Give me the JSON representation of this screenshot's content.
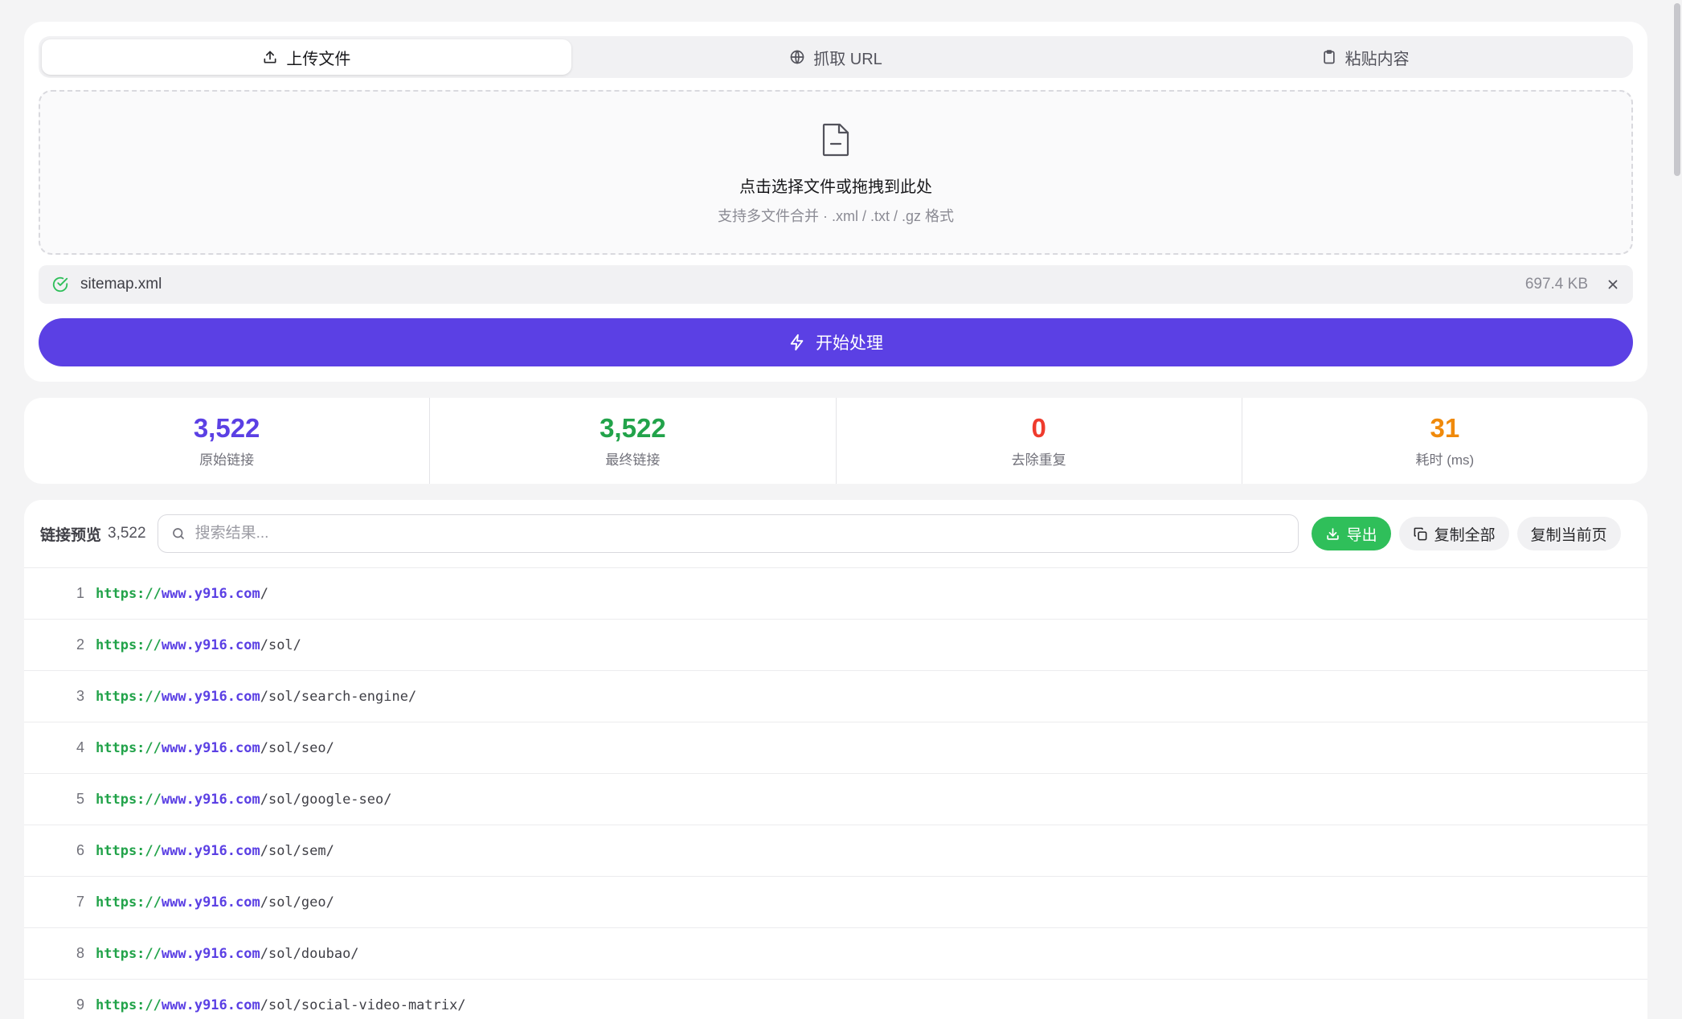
{
  "tabs": [
    {
      "label": "上传文件",
      "icon": "upload-icon",
      "active": true
    },
    {
      "label": "抓取 URL",
      "icon": "globe-icon",
      "active": false
    },
    {
      "label": "粘贴内容",
      "icon": "clipboard-icon",
      "active": false
    }
  ],
  "dropzone": {
    "title": "点击选择文件或拖拽到此处",
    "subtitle": "支持多文件合并 · .xml / .txt / .gz 格式",
    "icon": "file-icon"
  },
  "file": {
    "name": "sitemap.xml",
    "size": "697.4 KB",
    "status_icon": "check-circle-icon",
    "remove_icon": "close-icon"
  },
  "start_button": {
    "label": "开始处理",
    "icon": "lightning-icon"
  },
  "stats": [
    {
      "value": "3,522",
      "label": "原始链接",
      "color": "#5b40e4"
    },
    {
      "value": "3,522",
      "label": "最终链接",
      "color": "#22a34a"
    },
    {
      "value": "0",
      "label": "去除重复",
      "color": "#ef3b2d"
    },
    {
      "value": "31",
      "label": "耗时 (ms)",
      "color": "#f08a0b"
    }
  ],
  "preview": {
    "title": "链接预览",
    "count": "3,522",
    "search_placeholder": "搜索结果...",
    "export_label": "导出",
    "copy_all_label": "复制全部",
    "copy_page_label": "复制当前页"
  },
  "links": [
    {
      "index": "1",
      "proto": "https://",
      "host": "www.y916.com",
      "path": "/"
    },
    {
      "index": "2",
      "proto": "https://",
      "host": "www.y916.com",
      "path": "/sol/"
    },
    {
      "index": "3",
      "proto": "https://",
      "host": "www.y916.com",
      "path": "/sol/search-engine/"
    },
    {
      "index": "4",
      "proto": "https://",
      "host": "www.y916.com",
      "path": "/sol/seo/"
    },
    {
      "index": "5",
      "proto": "https://",
      "host": "www.y916.com",
      "path": "/sol/google-seo/"
    },
    {
      "index": "6",
      "proto": "https://",
      "host": "www.y916.com",
      "path": "/sol/sem/"
    },
    {
      "index": "7",
      "proto": "https://",
      "host": "www.y916.com",
      "path": "/sol/geo/"
    },
    {
      "index": "8",
      "proto": "https://",
      "host": "www.y916.com",
      "path": "/sol/doubao/"
    },
    {
      "index": "9",
      "proto": "https://",
      "host": "www.y916.com",
      "path": "/sol/social-video-matrix/"
    }
  ]
}
